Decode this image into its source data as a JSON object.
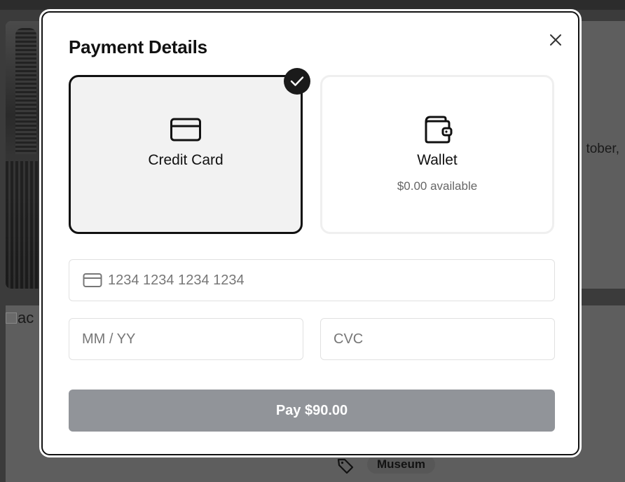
{
  "background": {
    "side_text": "tober,",
    "image_alt": "ac",
    "tag_label": "Museum"
  },
  "modal": {
    "title": "Payment Details",
    "close_icon": "close-icon",
    "methods": [
      {
        "label": "Credit Card",
        "icon": "credit-card-icon",
        "selected": true
      },
      {
        "label": "Wallet",
        "icon": "wallet-icon",
        "sublabel": "$0.00 available",
        "selected": false
      }
    ],
    "card_number": {
      "placeholder": "1234 1234 1234 1234",
      "value": ""
    },
    "expiry": {
      "placeholder": "MM / YY",
      "value": ""
    },
    "cvc": {
      "placeholder": "CVC",
      "value": ""
    },
    "pay_button": {
      "label": "Pay $90.00"
    }
  },
  "colors": {
    "selected_border": "#111111",
    "pay_button_bg": "#919499",
    "overlay": "#3b3b3b"
  }
}
